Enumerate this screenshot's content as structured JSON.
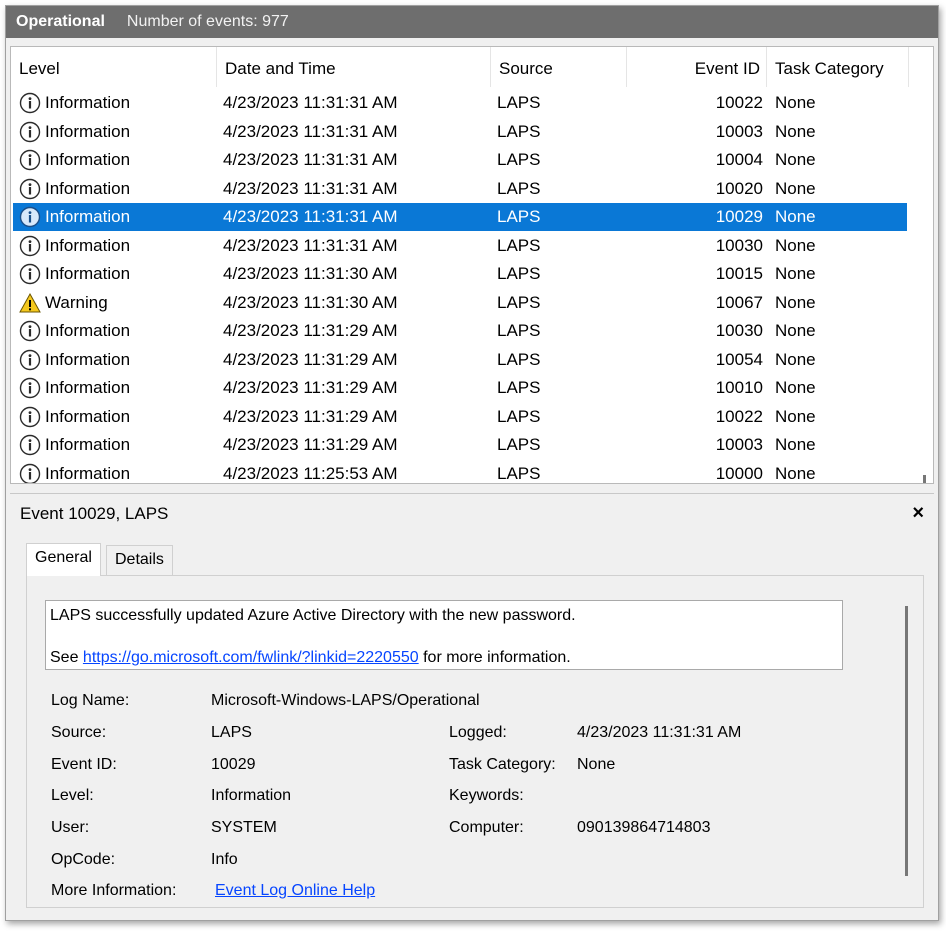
{
  "header": {
    "title": "Operational",
    "count_text": "Number of events: 977"
  },
  "columns": {
    "level": "Level",
    "date": "Date and Time",
    "source": "Source",
    "event_id": "Event ID",
    "category": "Task Category"
  },
  "rows": [
    {
      "level": "Information",
      "icon": "info-icon",
      "date": "4/23/2023 11:31:31 AM",
      "source": "LAPS",
      "event_id": "10022",
      "category": "None"
    },
    {
      "level": "Information",
      "icon": "info-icon",
      "date": "4/23/2023 11:31:31 AM",
      "source": "LAPS",
      "event_id": "10003",
      "category": "None"
    },
    {
      "level": "Information",
      "icon": "info-icon",
      "date": "4/23/2023 11:31:31 AM",
      "source": "LAPS",
      "event_id": "10004",
      "category": "None"
    },
    {
      "level": "Information",
      "icon": "info-icon",
      "date": "4/23/2023 11:31:31 AM",
      "source": "LAPS",
      "event_id": "10020",
      "category": "None"
    },
    {
      "level": "Information",
      "icon": "info-icon",
      "date": "4/23/2023 11:31:31 AM",
      "source": "LAPS",
      "event_id": "10029",
      "category": "None",
      "selected": true
    },
    {
      "level": "Information",
      "icon": "info-icon",
      "date": "4/23/2023 11:31:31 AM",
      "source": "LAPS",
      "event_id": "10030",
      "category": "None"
    },
    {
      "level": "Information",
      "icon": "info-icon",
      "date": "4/23/2023 11:31:30 AM",
      "source": "LAPS",
      "event_id": "10015",
      "category": "None"
    },
    {
      "level": "Warning",
      "icon": "warning-icon",
      "date": "4/23/2023 11:31:30 AM",
      "source": "LAPS",
      "event_id": "10067",
      "category": "None"
    },
    {
      "level": "Information",
      "icon": "info-icon",
      "date": "4/23/2023 11:31:29 AM",
      "source": "LAPS",
      "event_id": "10030",
      "category": "None"
    },
    {
      "level": "Information",
      "icon": "info-icon",
      "date": "4/23/2023 11:31:29 AM",
      "source": "LAPS",
      "event_id": "10054",
      "category": "None"
    },
    {
      "level": "Information",
      "icon": "info-icon",
      "date": "4/23/2023 11:31:29 AM",
      "source": "LAPS",
      "event_id": "10010",
      "category": "None"
    },
    {
      "level": "Information",
      "icon": "info-icon",
      "date": "4/23/2023 11:31:29 AM",
      "source": "LAPS",
      "event_id": "10022",
      "category": "None"
    },
    {
      "level": "Information",
      "icon": "info-icon",
      "date": "4/23/2023 11:31:29 AM",
      "source": "LAPS",
      "event_id": "10003",
      "category": "None"
    },
    {
      "level": "Information",
      "icon": "info-icon",
      "date": "4/23/2023 11:25:53 AM",
      "source": "LAPS",
      "event_id": "10000",
      "category": "None"
    }
  ],
  "detail": {
    "title": "Event 10029, LAPS",
    "close": "×",
    "tabs": {
      "general": "General",
      "details": "Details"
    },
    "message": {
      "line1": "LAPS successfully updated Azure Active Directory with the new password.",
      "see_prefix": "See ",
      "link": "https://go.microsoft.com/fwlink/?linkid=2220550",
      "see_suffix": " for more information."
    },
    "fields": {
      "log_name_label": "Log Name:",
      "log_name": "Microsoft-Windows-LAPS/Operational",
      "source_label": "Source:",
      "source": "LAPS",
      "logged_label": "Logged:",
      "logged": "4/23/2023 11:31:31 AM",
      "event_id_label": "Event ID:",
      "event_id": "10029",
      "task_category_label": "Task Category:",
      "task_category": "None",
      "level_label": "Level:",
      "level": "Information",
      "keywords_label": "Keywords:",
      "user_label": "User:",
      "user": "SYSTEM",
      "computer_label": "Computer:",
      "computer": "090139864714803",
      "opcode_label": "OpCode:",
      "opcode": "Info",
      "more_info_label": "More Information:",
      "more_info_link": "Event Log Online Help"
    }
  },
  "colors": {
    "selection": "#0a78d6",
    "link": "#0645ff",
    "header_bg": "#6e6e6e"
  }
}
